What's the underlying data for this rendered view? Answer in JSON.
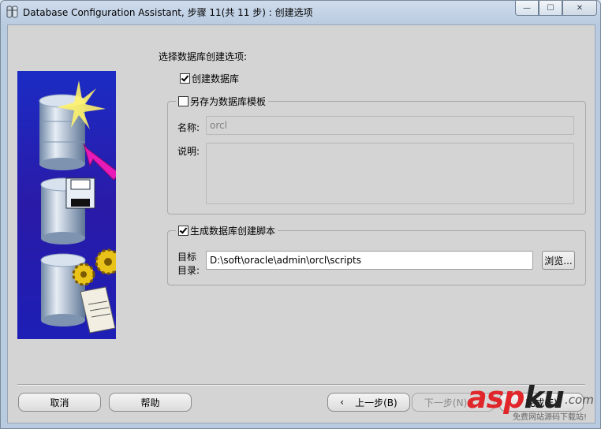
{
  "window": {
    "title": "Database Configuration Assistant, 步骤 11(共 11 步) : 创建选项",
    "controls": {
      "minimize": "—",
      "maximize": "☐",
      "close": "✕"
    }
  },
  "main": {
    "heading": "选择数据库创建选项:",
    "create_database": {
      "label": "创建数据库",
      "checked": true
    },
    "save_template": {
      "label": "另存为数据库模板",
      "checked": false,
      "name_label": "名称:",
      "name_value": "orcl",
      "desc_label": "说明:",
      "desc_value": ""
    },
    "generate_scripts": {
      "label": "生成数据库创建脚本",
      "checked": true,
      "dest_label_line1": "目标",
      "dest_label_line2": "目录:",
      "dest_value": "D:\\soft\\oracle\\admin\\orcl\\scripts",
      "browse_label": "浏览..."
    }
  },
  "footer": {
    "cancel_label": "取消",
    "help_label": "帮助",
    "back_label": "上一步(B)",
    "next_label": "下一步(N)",
    "finish_label": "完成(F)"
  },
  "watermark": {
    "brand_a": "asp",
    "brand_b": "ku",
    "suffix": ".com",
    "subtitle": "免费网站源码下载站!"
  },
  "colors": {
    "client_bg": "#d4d4d4",
    "image_bg": "#1a1fb8",
    "watermark_red": "#e0262b"
  }
}
